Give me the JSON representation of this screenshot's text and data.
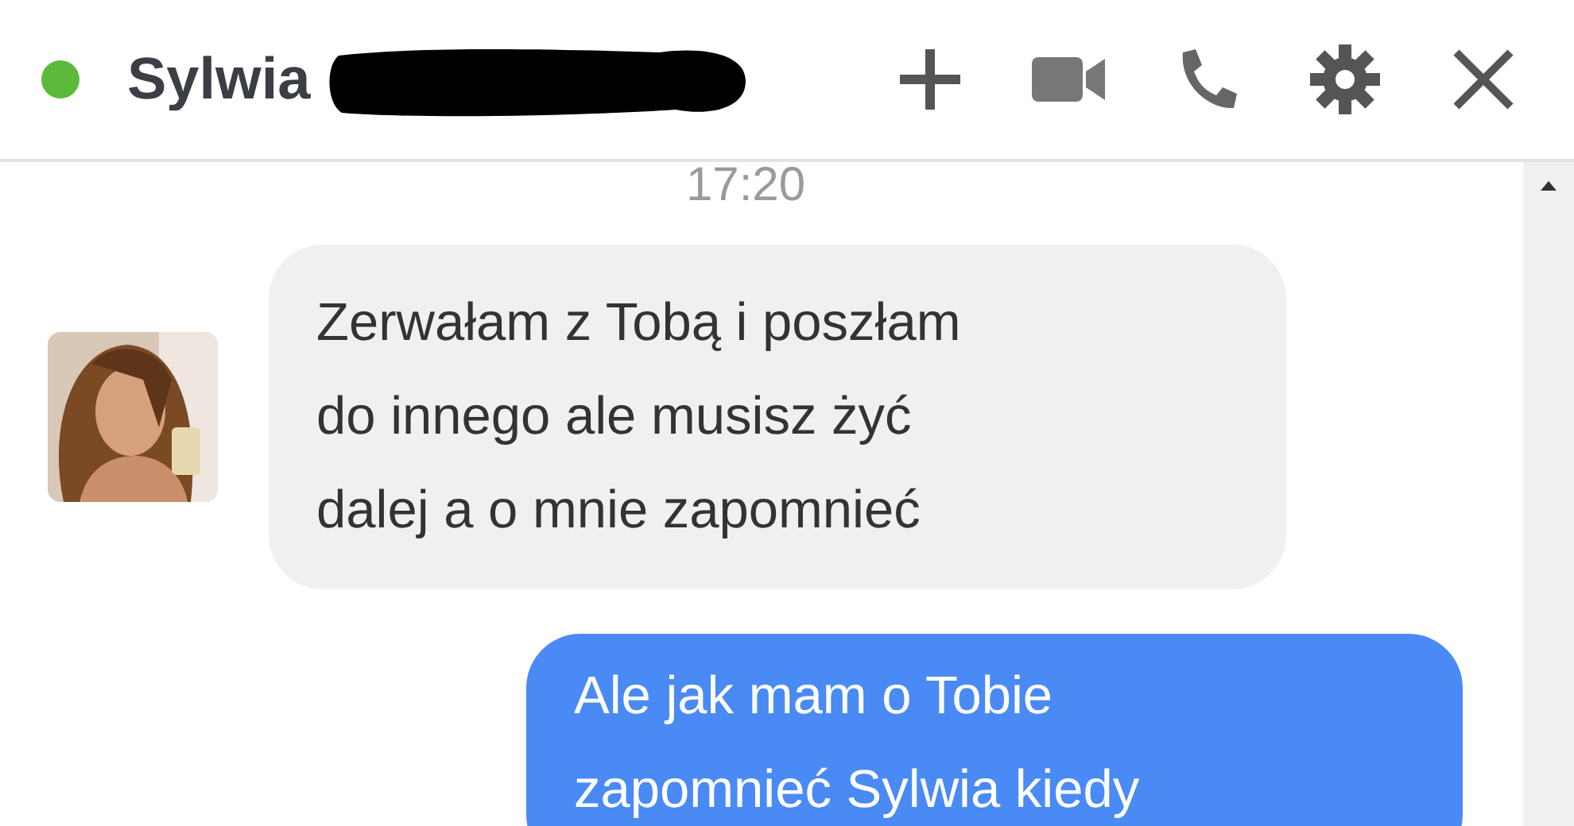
{
  "header": {
    "name": "Sylwia",
    "online": true
  },
  "timestamp": "17:20",
  "messages": [
    {
      "kind": "incoming",
      "text": "Zerwałam z Tobą i poszłam\ndo innego ale musisz żyć\ndalej a o mnie zapomnieć"
    },
    {
      "kind": "outgoing",
      "text": "Ale jak mam o Tobie\nzapomnieć Sylwia kiedy"
    }
  ]
}
